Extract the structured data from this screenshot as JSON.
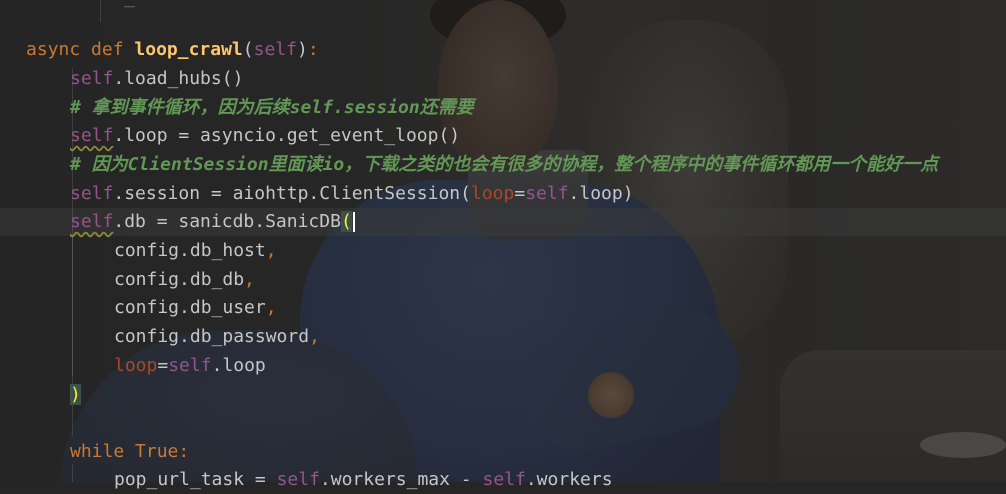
{
  "editor": {
    "top_fragment": "_",
    "lines": {
      "l_def": {
        "kw_async": "async",
        "kw_def": "def",
        "name": "loop_crawl",
        "open": "(",
        "param": "self",
        "close": ")",
        "colon": ":"
      },
      "l_load": {
        "self": "self",
        "rest": ".load_hubs()"
      },
      "l_c1": {
        "text": "# 拿到事件循环，因为后续self.session还需要"
      },
      "l_loop": {
        "self": "self",
        "rest": ".loop = asyncio.get_event_loop()"
      },
      "l_c2": {
        "text": "# 因为ClientSession里面读io，下载之类的也会有很多的协程，整个程序中的事件循环都用一个能好一点"
      },
      "l_session": {
        "self": "self",
        "mid": ".session = aiohttp.ClientSession(",
        "kwarg": "loop",
        "eq": "=",
        "self2": "self",
        "end": ".loop)"
      },
      "l_db": {
        "self": "self",
        "rest": ".db = sanicdb.SanicDB",
        "paren": "("
      },
      "l_host": {
        "text": "config.db_host",
        "comma": ","
      },
      "l_dbdb": {
        "text": "config.db_db",
        "comma": ","
      },
      "l_user": {
        "text": "config.db_user",
        "comma": ","
      },
      "l_pass": {
        "text": "config.db_password",
        "comma": ","
      },
      "l_kw": {
        "kwarg": "loop",
        "eq": "=",
        "self": "self",
        "rest": ".loop"
      },
      "l_close": {
        "paren": ")"
      },
      "l_while": {
        "kw_while": "while",
        "kw_true": "True",
        "colon": ":"
      },
      "l_last": {
        "a": "pop_url_task = ",
        "self1": "self",
        "b": ".workers_max - ",
        "self2": "self",
        "c": ".workers"
      }
    }
  },
  "colors": {
    "keyword": "#cc7832",
    "self": "#94558d",
    "function": "#ffc66d",
    "comment": "#629755",
    "param": "#aa4926",
    "text": "#c6c6c6"
  }
}
